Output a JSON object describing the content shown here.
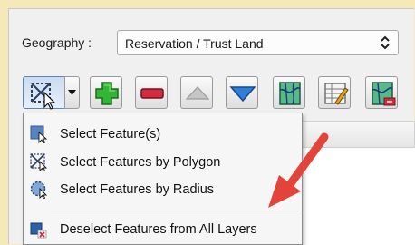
{
  "geography": {
    "label": "Geography :",
    "selected": "Reservation / Trust Land"
  },
  "toolbar": {
    "buttons": [
      {
        "icon": "select-feature-icon",
        "tooltip": ""
      },
      {
        "icon": "add-icon"
      },
      {
        "icon": "remove-icon"
      },
      {
        "icon": "move-up-icon"
      },
      {
        "icon": "move-down-icon"
      },
      {
        "icon": "map-layer-icon"
      },
      {
        "icon": "attribute-table-edit-icon"
      },
      {
        "icon": "map-remove-icon"
      }
    ]
  },
  "select_menu": {
    "items": [
      {
        "label": "Select Feature(s)",
        "icon": "select-rectangle-icon"
      },
      {
        "label": "Select Features by Polygon",
        "icon": "select-polygon-icon"
      },
      {
        "label": "Select Features by Radius",
        "icon": "select-radius-icon"
      },
      {
        "label": "Deselect Features from All Layers",
        "icon": "deselect-icon"
      }
    ]
  },
  "colors": {
    "frame_background": "#f5e9b8",
    "panel": "#f0f0f0",
    "annotation_arrow": "#e2433a",
    "add_green": "#2ea82e",
    "remove_red": "#d0243a",
    "down_blue": "#2f7fd8"
  }
}
